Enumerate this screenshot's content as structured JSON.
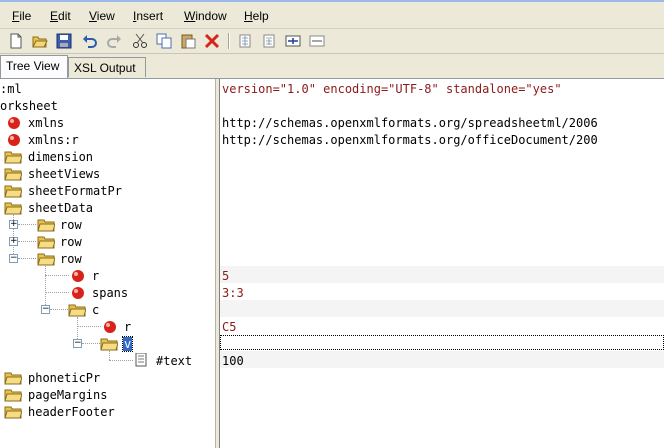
{
  "menu": [
    "File",
    "Edit",
    "View",
    "Insert",
    "Window",
    "Help"
  ],
  "toolbar": [
    "new-file-icon",
    "open-folder-icon",
    "save-icon",
    "undo-icon",
    "redo-icon",
    "cut-icon",
    "copy-icon",
    "paste-icon",
    "delete-icon",
    "indent-icon",
    "outdent-icon",
    "expand-icon",
    "collapse-icon"
  ],
  "tabs": [
    "Tree View",
    "XSL Output"
  ],
  "tree": {
    "xml": ":ml",
    "worksheet": "orksheet",
    "xmlns": "xmlns",
    "xmlns_r": "xmlns:r",
    "dimension": "dimension",
    "sheetViews": "sheetViews",
    "sheetFormatPr": "sheetFormatPr",
    "sheetData": "sheetData",
    "row1": "row",
    "row2": "row",
    "row3": "row",
    "r": "r",
    "spans": "spans",
    "c": "c",
    "c_r": "r",
    "v": "v",
    "text": "#text",
    "phoneticPr": "phoneticPr",
    "pageMargins": "pageMargins",
    "headerFooter": "headerFooter"
  },
  "values": {
    "xml": "version=\"1.0\" encoding=\"UTF-8\" standalone=\"yes\"",
    "xmlns": "http://schemas.openxmlformats.org/spreadsheetml/2006",
    "xmlns_r": "http://schemas.openxmlformats.org/officeDocument/200",
    "r": "5",
    "spans": "3:3",
    "c_r": "C5",
    "text": "100"
  },
  "colors": {
    "folder": "#e8c24a",
    "attribute": "#d8231b",
    "selection": "#316ac5"
  }
}
